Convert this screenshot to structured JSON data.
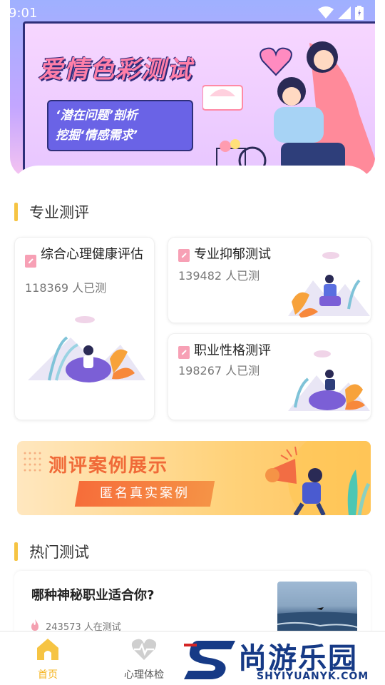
{
  "status_bar": {
    "time": "9:01"
  },
  "banner": {
    "title": "爱情色彩测试",
    "sub_line1": "‘潜在问题’剖析",
    "sub_line2": "挖掘‘情感需求’"
  },
  "sections": {
    "pro_title": "专业测评",
    "hot_title": "热门测试"
  },
  "pro_cards": [
    {
      "title": "综合心理健康评估",
      "count": "118369 人已测"
    },
    {
      "title": "专业抑郁测试",
      "count": "139482 人已测"
    },
    {
      "title": "职业性格测评",
      "count": "198267 人已测"
    }
  ],
  "case_banner": {
    "title": "测评案例展示",
    "button": "匿名真实案例"
  },
  "hot_items": [
    {
      "title": "哪种神秘职业适合你?",
      "count": "243573 人在测试"
    }
  ],
  "bottom_nav": [
    {
      "label": "首页",
      "icon": "home-icon",
      "active": true
    },
    {
      "label": "心理体检",
      "icon": "heart-pulse-icon",
      "active": false
    }
  ],
  "watermark": {
    "brand_cn": "尚游乐园",
    "brand_en": "SHYIYUANYK.COM"
  },
  "colors": {
    "accent": "#f6c443",
    "active_nav": "#f6b41f",
    "inactive_nav": "#555555"
  }
}
